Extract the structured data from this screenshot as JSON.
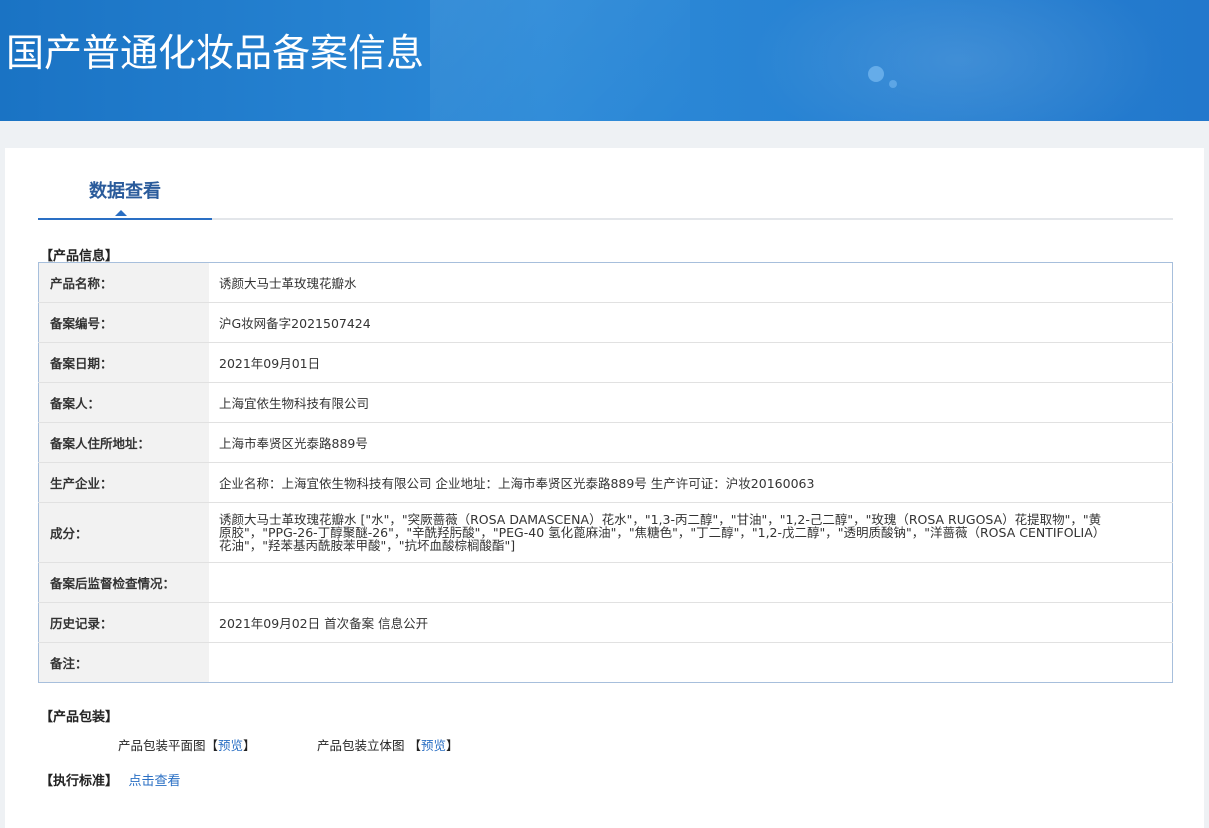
{
  "header": {
    "title": "国产普通化妆品备案信息"
  },
  "tabs": [
    {
      "label": "数据查看"
    }
  ],
  "product_info": {
    "section_title": "【产品信息】",
    "rows": [
      {
        "label": "产品名称：",
        "value": "诱颜大马士革玫瑰花瓣水"
      },
      {
        "label": "备案编号：",
        "value": "沪G妆网备字2021507424"
      },
      {
        "label": "备案日期：",
        "value": "2021年09月01日"
      },
      {
        "label": "备案人：",
        "value": "上海宜依生物科技有限公司"
      },
      {
        "label": "备案人住所地址：",
        "value": "上海市奉贤区光泰路889号"
      },
      {
        "label": "生产企业：",
        "value": "企业名称：上海宜依生物科技有限公司 企业地址：上海市奉贤区光泰路889号 生产许可证：沪妆20160063"
      },
      {
        "label": "成分：",
        "value": "诱颜大马士革玫瑰花瓣水 [\"水\"，\"突厥蔷薇（ROSA DAMASCENA）花水\"，\"1,3-丙二醇\"，\"甘油\"，\"1,2-己二醇\"，\"玫瑰（ROSA RUGOSA）花提取物\"，\"黄原胶\"，\"PPG-26-丁醇聚醚-26\"，\"辛酰羟肟酸\"，\"PEG-40 氢化蓖麻油\"，\"焦糖色\"，\"丁二醇\"，\"1,2-戊二醇\"，\"透明质酸钠\"，\"洋蔷薇（ROSA CENTIFOLIA）花油\"，\"羟苯基丙酰胺苯甲酸\"，\"抗坏血酸棕榈酸酯\"]"
      },
      {
        "label": "备案后监督检查情况：",
        "value": ""
      },
      {
        "label": "历史记录：",
        "value": "2021年09月02日 首次备案 信息公开"
      },
      {
        "label": "备注：",
        "value": ""
      }
    ]
  },
  "packaging": {
    "section_title": "【产品包装】",
    "flat": {
      "label": "产品包装平面图",
      "link": "预览"
    },
    "three_d": {
      "label": "产品包装立体图",
      "link": "预览"
    }
  },
  "standard": {
    "section_title": "【执行标准】",
    "link": "点击查看"
  }
}
